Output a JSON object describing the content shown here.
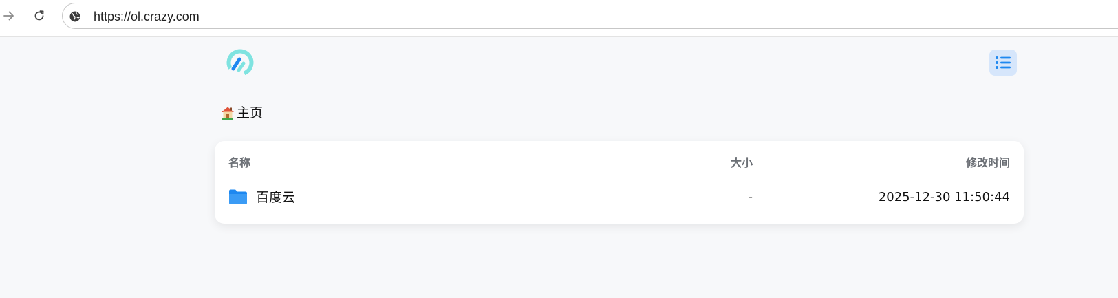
{
  "browser": {
    "url": "https://ol.crazy.com"
  },
  "header": {
    "logo_icon": "logo-icon",
    "menu_icon": "list-icon",
    "menu_button_color": "#d6e6fb",
    "accent_color": "#1e88f0"
  },
  "breadcrumb": {
    "home_icon": "house-icon",
    "label": "主页"
  },
  "file_list": {
    "columns": {
      "name": "名称",
      "size": "大小",
      "modified": "修改时间"
    },
    "rows": [
      {
        "icon": "folder-icon",
        "name": "百度云",
        "size": "-",
        "modified": "2025-12-30 11:50:44"
      }
    ]
  }
}
